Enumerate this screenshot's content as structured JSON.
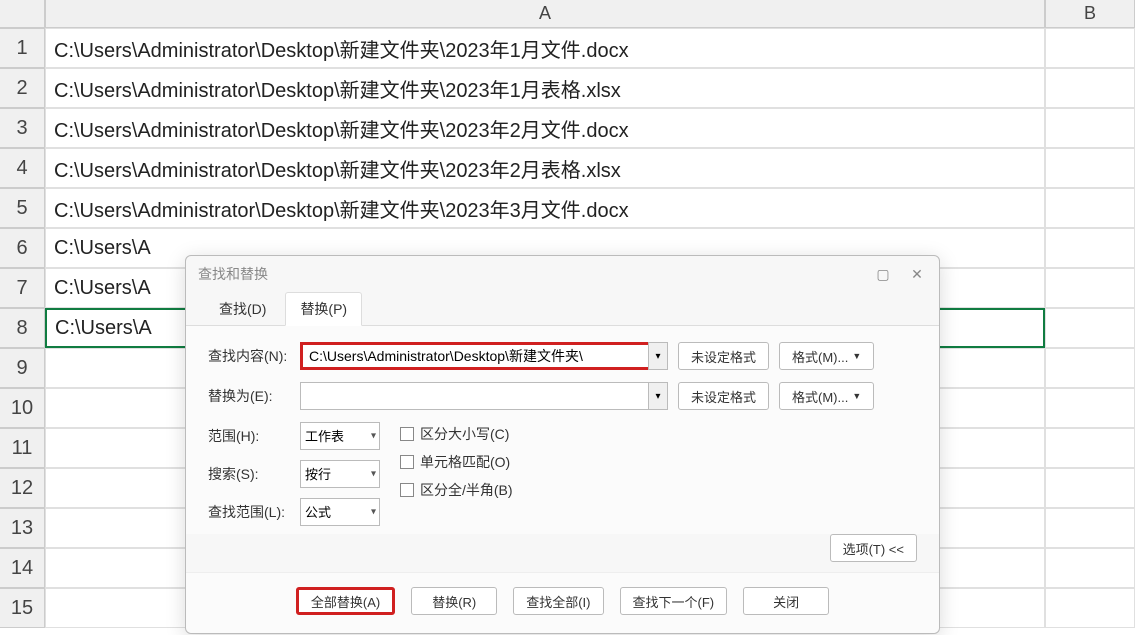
{
  "columns": [
    "A",
    "B"
  ],
  "rows": [
    {
      "n": "1",
      "a": "C:\\Users\\Administrator\\Desktop\\新建文件夹\\2023年1月文件.docx"
    },
    {
      "n": "2",
      "a": "C:\\Users\\Administrator\\Desktop\\新建文件夹\\2023年1月表格.xlsx"
    },
    {
      "n": "3",
      "a": "C:\\Users\\Administrator\\Desktop\\新建文件夹\\2023年2月文件.docx"
    },
    {
      "n": "4",
      "a": "C:\\Users\\Administrator\\Desktop\\新建文件夹\\2023年2月表格.xlsx"
    },
    {
      "n": "5",
      "a": "C:\\Users\\Administrator\\Desktop\\新建文件夹\\2023年3月文件.docx"
    },
    {
      "n": "6",
      "a": "C:\\Users\\A"
    },
    {
      "n": "7",
      "a": "C:\\Users\\A"
    },
    {
      "n": "8",
      "a": "C:\\Users\\A"
    },
    {
      "n": "9",
      "a": ""
    },
    {
      "n": "10",
      "a": ""
    },
    {
      "n": "11",
      "a": ""
    },
    {
      "n": "12",
      "a": ""
    },
    {
      "n": "13",
      "a": ""
    },
    {
      "n": "14",
      "a": ""
    },
    {
      "n": "15",
      "a": ""
    }
  ],
  "selected_row": 8,
  "dialog": {
    "title": "查找和替换",
    "tabs": {
      "find": "查找(D)",
      "replace": "替换(P)"
    },
    "labels": {
      "find_what": "查找内容(N):",
      "replace_with": "替换为(E):",
      "within": "范围(H):",
      "search": "搜索(S):",
      "look_in": "查找范围(L):"
    },
    "find_value": "C:\\Users\\Administrator\\Desktop\\新建文件夹\\",
    "replace_value": "",
    "no_format_set": "未设定格式",
    "format_btn": "格式(M)...",
    "within_value": "工作表",
    "search_value": "按行",
    "look_in_value": "公式",
    "checks": {
      "match_case": "区分大小写(C)",
      "match_cell": "单元格匹配(O)",
      "match_width": "区分全/半角(B)"
    },
    "options_btn": "选项(T) <<",
    "buttons": {
      "replace_all": "全部替换(A)",
      "replace": "替换(R)",
      "find_all": "查找全部(I)",
      "find_next": "查找下一个(F)",
      "close": "关闭"
    }
  }
}
